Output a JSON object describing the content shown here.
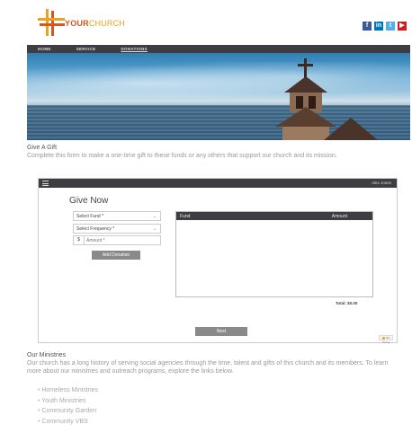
{
  "header": {
    "logo_bold": "YOUR",
    "logo_light": "CHURCH",
    "social": [
      "f",
      "in",
      "t",
      "▶"
    ]
  },
  "nav": {
    "items": [
      "HOME",
      "SERVICE",
      "DONATIONS"
    ]
  },
  "gift": {
    "title": "Give A Gift",
    "description": "Complete this form to make a one-time gift to these funds or any others that support our church and its mission."
  },
  "form": {
    "user_name": "Alex Jones",
    "heading": "Give Now",
    "select_fund": "Select Fund *",
    "select_frequency": "Select Frequency *",
    "currency_symbol": "$",
    "amount_placeholder": "Amount *",
    "add_button": "Add Donation",
    "table_headers": [
      "Fund",
      "Amount"
    ],
    "total_label": "Total: $0.00",
    "next_button": "Next",
    "badge": "EZ Giving"
  },
  "ministries": {
    "title": "Our Ministries",
    "description": "Our church has a long history of serving social agencies through the time, talent and gifts of this church and its members. To learn more about our ministries and outreach programs, explore the links below.",
    "items": [
      "Homeless Ministries",
      "Youth Ministries",
      "Community Garden",
      "Community VBS"
    ]
  }
}
